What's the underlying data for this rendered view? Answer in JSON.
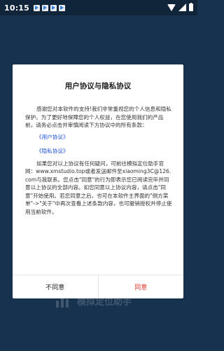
{
  "status_bar": {
    "time": "10:15",
    "notification_icons": [
      "play-store-icon",
      "play-store-icon",
      "play-store-icon",
      "play-store-icon"
    ],
    "right_icons": [
      "wifi-icon",
      "signal-icon",
      "battery-icon"
    ]
  },
  "background": {
    "app_logo_text": "模拟定位助手"
  },
  "dialog": {
    "title": "用户协议与隐私协议",
    "paragraph_1": "感谢您对本软件的支持!我们非常重视您的个人信息和隐私保护。为了更好地保障您的个人权益，在您使用我们的产品前，请务必点击并审慎阅读下方协议中的所有条款：",
    "link_user_agreement": "《用户协议》",
    "link_privacy_agreement": "《隐私协议》",
    "paragraph_2": "如果您对以上协议有任何疑问，可前往模拟定位助手官网：www.xmstudio.top或者发送邮件至xiaoming3C@126.com与我联系。您点击\"同意\"的行为即表示您已阅读完毕并同意以上协议的全部内容。如您同意以上协议内容，请点击\"同意\"开始使用。若您同意之后，也可在本软件主界面的\"侧方菜单\"->\"关于\"中再次查看上述条款内容，也可撤销授权并停止使用当前软件。",
    "disagree_label": "不同意",
    "agree_label": "同意"
  },
  "colors": {
    "background": "#16324e",
    "status_bar": "#10253a",
    "link": "#1a4fd6",
    "agree": "#e0352b"
  }
}
